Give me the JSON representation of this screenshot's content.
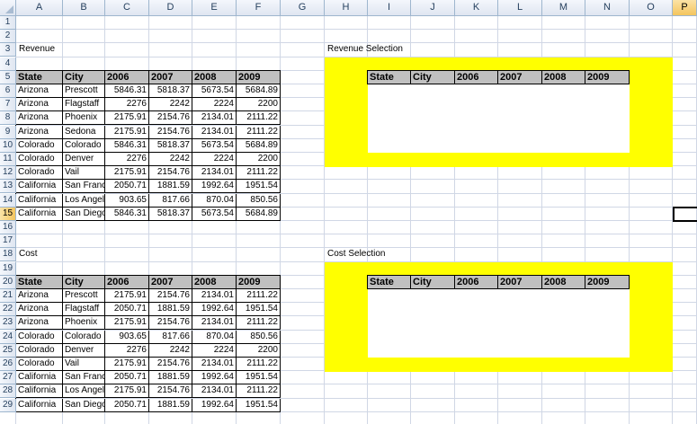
{
  "columns": [
    "A",
    "B",
    "C",
    "D",
    "E",
    "F",
    "G",
    "H",
    "I",
    "J",
    "K",
    "L",
    "M",
    "N",
    "O",
    "P"
  ],
  "rows": [
    "1",
    "2",
    "3",
    "4",
    "5",
    "6",
    "7",
    "8",
    "9",
    "10",
    "11",
    "12",
    "13",
    "14",
    "15",
    "16",
    "17",
    "18",
    "19",
    "20",
    "21",
    "22",
    "23",
    "24",
    "25",
    "26",
    "27",
    "28",
    "29"
  ],
  "revenue": {
    "title": "Revenue",
    "headers": [
      "State",
      "City",
      "2006",
      "2007",
      "2008",
      "2009"
    ],
    "rows": [
      [
        "Arizona",
        "Prescott",
        "5846.31",
        "5818.37",
        "5673.54",
        "5684.89"
      ],
      [
        "Arizona",
        "Flagstaff",
        "2276",
        "2242",
        "2224",
        "2200"
      ],
      [
        "Arizona",
        "Phoenix",
        "2175.91",
        "2154.76",
        "2134.01",
        "2111.22"
      ],
      [
        "Arizona",
        "Sedona",
        "2175.91",
        "2154.76",
        "2134.01",
        "2111.22"
      ],
      [
        "Colorado",
        "Colorado S",
        "5846.31",
        "5818.37",
        "5673.54",
        "5684.89"
      ],
      [
        "Colorado",
        "Denver",
        "2276",
        "2242",
        "2224",
        "2200"
      ],
      [
        "Colorado",
        "Vail",
        "2175.91",
        "2154.76",
        "2134.01",
        "2111.22"
      ],
      [
        "California",
        "San Franci",
        "2050.71",
        "1881.59",
        "1992.64",
        "1951.54"
      ],
      [
        "California",
        "Los Angele",
        "903.65",
        "817.66",
        "870.04",
        "850.56"
      ],
      [
        "California",
        "San Diego",
        "5846.31",
        "5818.37",
        "5673.54",
        "5684.89"
      ]
    ]
  },
  "cost": {
    "title": "Cost",
    "headers": [
      "State",
      "City",
      "2006",
      "2007",
      "2008",
      "2009"
    ],
    "rows": [
      [
        "Arizona",
        "Prescott",
        "2175.91",
        "2154.76",
        "2134.01",
        "2111.22"
      ],
      [
        "Arizona",
        "Flagstaff",
        "2050.71",
        "1881.59",
        "1992.64",
        "1951.54"
      ],
      [
        "Arizona",
        "Phoenix",
        "2175.91",
        "2154.76",
        "2134.01",
        "2111.22"
      ],
      [
        "Colorado",
        "Colorado S",
        "903.65",
        "817.66",
        "870.04",
        "850.56"
      ],
      [
        "Colorado",
        "Denver",
        "2276",
        "2242",
        "2224",
        "2200"
      ],
      [
        "Colorado",
        "Vail",
        "2175.91",
        "2154.76",
        "2134.01",
        "2111.22"
      ],
      [
        "California",
        "San Franci",
        "2050.71",
        "1881.59",
        "1992.64",
        "1951.54"
      ],
      [
        "California",
        "Los Angele",
        "2175.91",
        "2154.76",
        "2134.01",
        "2111.22"
      ],
      [
        "California",
        "San Diego",
        "2050.71",
        "1881.59",
        "1992.64",
        "1951.54"
      ]
    ]
  },
  "revenue_selection": {
    "title": "Revenue Selection",
    "headers": [
      "State",
      "City",
      "2006",
      "2007",
      "2008",
      "2009"
    ]
  },
  "cost_selection": {
    "title": "Cost Selection",
    "headers": [
      "State",
      "City",
      "2006",
      "2007",
      "2008",
      "2009"
    ]
  },
  "colors": {
    "highlight": "#ffff00",
    "header_fill": "#c0c0c0",
    "selected_header": "#f4c55e"
  },
  "selected_column": "P",
  "selected_row": "15"
}
